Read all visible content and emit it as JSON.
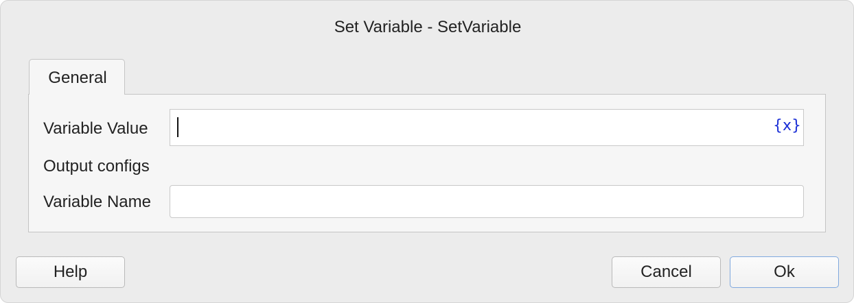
{
  "dialog": {
    "title": "Set Variable - SetVariable"
  },
  "tabs": [
    {
      "label": "General"
    }
  ],
  "form": {
    "variable_value": {
      "label": "Variable Value",
      "value": "",
      "insert_variable_icon": "{x}"
    },
    "section_heading": "Output configs",
    "variable_name": {
      "label": "Variable Name",
      "value": ""
    }
  },
  "buttons": {
    "help": "Help",
    "cancel": "Cancel",
    "ok": "Ok"
  },
  "colors": {
    "dialog_background": "#ececec",
    "panel_background": "#f6f6f6",
    "variable_icon": "#1b2fd6",
    "default_button_border": "#7fa8de"
  }
}
